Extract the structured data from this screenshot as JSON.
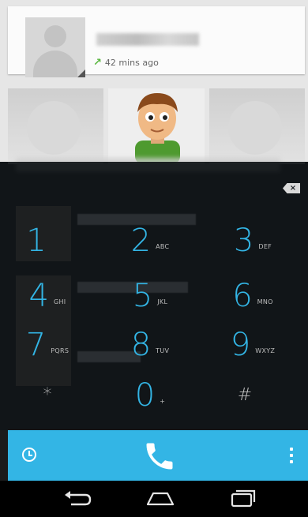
{
  "recent": {
    "time_ago": "42 mins ago"
  },
  "dialpad": {
    "keys": [
      {
        "digit": "1",
        "letters": ""
      },
      {
        "digit": "2",
        "letters": "ABC"
      },
      {
        "digit": "3",
        "letters": "DEF"
      },
      {
        "digit": "4",
        "letters": "GHI"
      },
      {
        "digit": "5",
        "letters": "JKL"
      },
      {
        "digit": "6",
        "letters": "MNO"
      },
      {
        "digit": "7",
        "letters": "PQRS"
      },
      {
        "digit": "8",
        "letters": "TUV"
      },
      {
        "digit": "9",
        "letters": "WXYZ"
      },
      {
        "digit": "*",
        "letters": ""
      },
      {
        "digit": "0",
        "letters": "+"
      },
      {
        "digit": "#",
        "letters": ""
      }
    ],
    "backspace_icon": "backspace-icon"
  },
  "action_bar": {
    "left_icon": "history-clock-icon",
    "center_icon": "phone-call-icon",
    "right_icon": "overflow-menu-icon"
  },
  "nav": {
    "icons": [
      "back-icon",
      "home-icon",
      "recent-apps-icon"
    ]
  },
  "colors": {
    "accent": "#33b5e5",
    "dialpad_bg": "#101418",
    "call_arrow": "#58b63e"
  }
}
